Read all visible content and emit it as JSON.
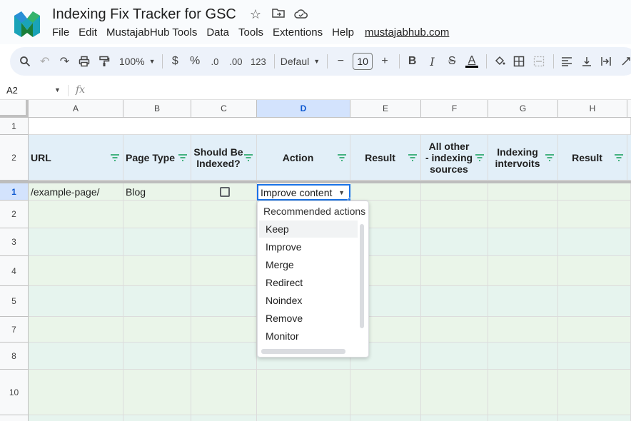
{
  "app": {
    "title": "Indexing Fix Tracker for GSC",
    "menu": [
      "File",
      "Edit",
      "MustajabHub Tools",
      "Data",
      "Tools",
      "Extentions",
      "Help"
    ],
    "menu_link": "mustajabhub.com"
  },
  "toolbar": {
    "zoom": "100%",
    "currency": "$",
    "percent": "%",
    "dec_less": ".0",
    "dec_more": ".00",
    "number_format": "123",
    "font": "Defaul",
    "font_size": "10",
    "minus": "−",
    "plus": "+",
    "bold": "B",
    "italic": "I",
    "strike": "S",
    "text_color_letter": "A"
  },
  "formula_bar": {
    "name_box": "A2",
    "fx": "fx"
  },
  "columns": [
    "A",
    "B",
    "C",
    "D",
    "E",
    "F",
    "G",
    "H"
  ],
  "selected_column": "D",
  "row_numbers": [
    "1",
    "2",
    "1",
    "2",
    "3",
    "4",
    "5",
    "7",
    "8",
    "10"
  ],
  "headers": [
    "URL",
    "Page Type",
    "Should Be Indexed?",
    "Action",
    "Result",
    "All other - indexing sources",
    "Indexing intervoits",
    "Result"
  ],
  "header_lines": {
    "should_be_indexed": [
      "Should Be",
      "Indexed?"
    ],
    "all_other": [
      "All other",
      "- indexing",
      "sources"
    ],
    "indexing_intervoits": [
      "Indexing",
      "intervoits"
    ]
  },
  "row1": {
    "url": "/example-page/",
    "page_type": "Blog",
    "should_be_indexed_checked": false,
    "action": "Improve content"
  },
  "dropdown": {
    "title": "Recommended actions",
    "items": [
      "Keep",
      "Improve",
      "Merge",
      "Redirect",
      "Noindex",
      "Remove",
      "Monitor"
    ],
    "highlighted": "Keep"
  },
  "colors": {
    "header_bg": "#e2eff8",
    "data_bg": "#eaf5e9",
    "selected_col_hdr": "#d3e3fd",
    "accent": "#1a73e8"
  }
}
